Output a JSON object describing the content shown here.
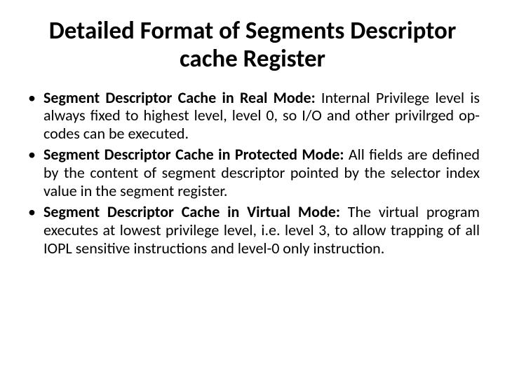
{
  "title": "Detailed Format of Segments Descriptor cache Register",
  "bullets": [
    {
      "lead": "Segment Descriptor Cache in Real Mode: ",
      "text": "Internal Privilege level is always fixed to highest level, level 0, so I/O and other privilrged op-codes can be executed."
    },
    {
      "lead": "Segment Descriptor Cache in Protected Mode: ",
      "text": " All fields are defined by the content of segment descriptor pointed by the selector index value in the segment register."
    },
    {
      "lead": "Segment Descriptor Cache in Virtual Mode: ",
      "text": "The virtual program executes at lowest privilege level, i.e. level 3, to allow trapping of all IOPL sensitive instructions and level-0 only instruction."
    }
  ]
}
